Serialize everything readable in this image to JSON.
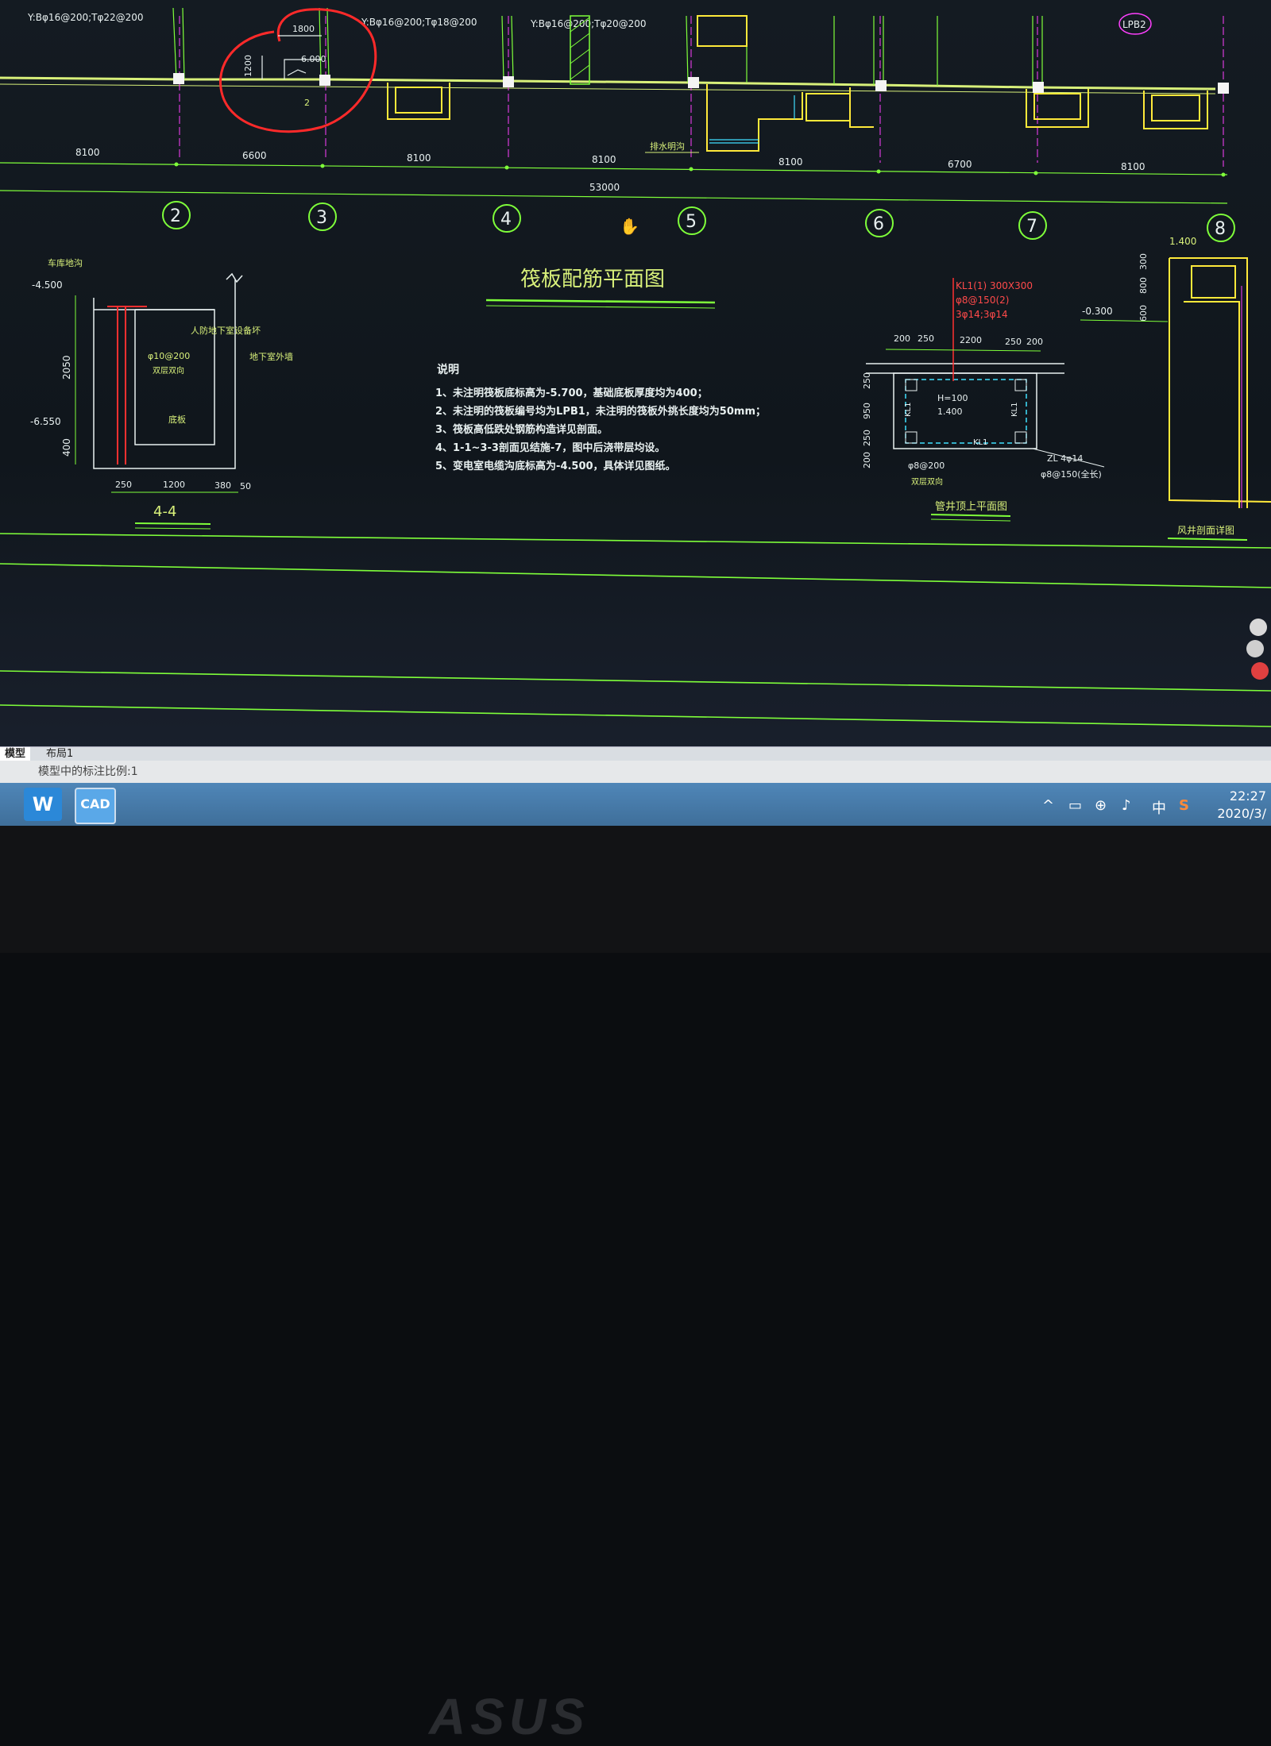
{
  "plan": {
    "top_labels": [
      "Y:Bφ16@200;Tφ22@200",
      "Y:Bφ16@200;Tφ18@200",
      "Y:Bφ16@200;Tφ20@200",
      "LPB2"
    ],
    "annotation": {
      "width": "1800",
      "height": "1200",
      "level": "-6.000",
      "mark": "2"
    },
    "spans": [
      "8100",
      "6600",
      "8100",
      "8100",
      "8100",
      "6700",
      "8100"
    ],
    "total": "53000",
    "drain_label": "排水明沟",
    "axes": [
      "2",
      "3",
      "4",
      "5",
      "6",
      "7",
      "8"
    ]
  },
  "title": "筏板配筋平面图",
  "notes": {
    "heading": "说明",
    "items": [
      "1、未注明筏板底标高为-5.700，基础底板厚度均为400；",
      "2、未注明的筏板编号均为LPB1，未注明的筏板外挑长度均为50mm；",
      "3、筏板高低跌处钢筋构造详见剖面。",
      "4、1-1~3-3剖面见结施-7，图中后浇带层均设。",
      "5、变电室电缆沟底标高为-4.500，具体详见图纸。"
    ]
  },
  "section44": {
    "name": "4-4",
    "top_label": "车库地沟",
    "levels": [
      "-4.500",
      "-6.550"
    ],
    "heights": [
      "2050",
      "400"
    ],
    "rebar": "φ10@200",
    "rebar_sub": "双层双向",
    "base": "底板",
    "side1": "人防地下室设备坏",
    "side2": "地下室外墙",
    "dims": [
      "250",
      "1200",
      "380",
      "50"
    ]
  },
  "pit": {
    "kl_lines": [
      "KL1(1) 300X300",
      "φ8@150(2)",
      "3φ14;3φ14"
    ],
    "dims_top": [
      "200",
      "250",
      "2200",
      "250",
      "200"
    ],
    "dims_side": [
      "250",
      "950",
      "250",
      "200"
    ],
    "inner": [
      "H=100",
      "1.400"
    ],
    "labels": [
      "KL1",
      "KL1",
      "KL1"
    ],
    "rebar": "φ8@200",
    "rebar_sub": "双层双向",
    "zl": "ZL 4φ14",
    "zl2": "φ8@150(全长)",
    "title": "管井顶上平面图"
  },
  "section_right": {
    "top": "1.400",
    "dims": [
      "300",
      "800",
      "600"
    ],
    "level": "-0.300",
    "title": "风井剖面详图"
  },
  "tabs": [
    "模型",
    "布局1"
  ],
  "status": "模型中的标注比例:1",
  "clock": {
    "time": "22:27",
    "date": "2020/3/"
  },
  "tray": {
    "ime": "中"
  },
  "taskbar_icons": [
    "wps-icon",
    "cad-icon"
  ],
  "brand": "ASUS",
  "colors": {
    "green": "#d8f07a",
    "line": "#7fff3a",
    "red": "#ff3030",
    "yellow": "#ffe93a",
    "magenta": "#ff40ff",
    "cyan": "#40e0ff"
  }
}
